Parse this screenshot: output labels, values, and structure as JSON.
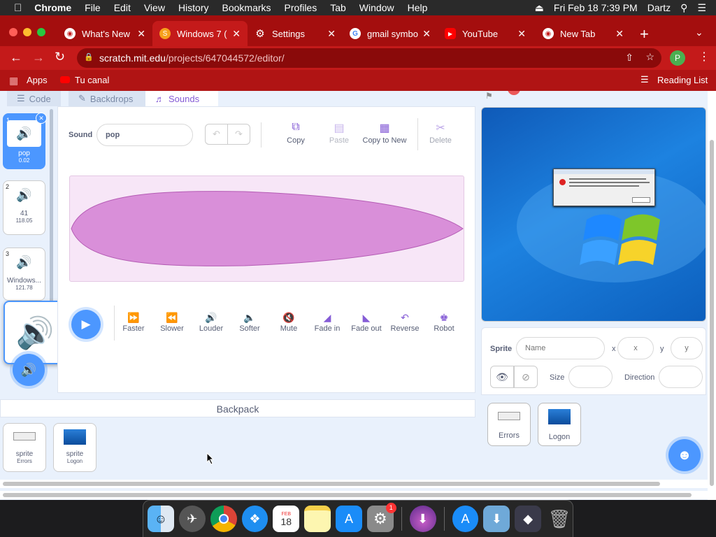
{
  "menubar": {
    "app": "Chrome",
    "items": [
      "File",
      "Edit",
      "View",
      "History",
      "Bookmarks",
      "Profiles",
      "Tab",
      "Window",
      "Help"
    ],
    "clock": "Fri Feb 18  7:39 PM",
    "user": "Dartz"
  },
  "tabs": [
    {
      "title": "What's New",
      "icon": "chrome-icon"
    },
    {
      "title": "Windows 7 (",
      "icon": "scratch-icon"
    },
    {
      "title": "Settings",
      "icon": "gear-icon"
    },
    {
      "title": "gmail symbo",
      "icon": "google-icon"
    },
    {
      "title": "YouTube",
      "icon": "youtube-icon"
    },
    {
      "title": "New Tab",
      "icon": "chrome-icon"
    }
  ],
  "address": {
    "host": "scratch.mit.edu",
    "path": "/projects/647044572/editor/",
    "profile": "P"
  },
  "bookmarks": {
    "apps": "Apps",
    "tu_canal": "Tu canal",
    "reading_list": "Reading List"
  },
  "scratch": {
    "tabs": {
      "code": "Code",
      "backdrops": "Backdrops",
      "sounds": "Sounds"
    },
    "sounds": [
      {
        "num": "1",
        "name": "pop",
        "dur": "0.02"
      },
      {
        "num": "2",
        "name": "41",
        "dur": "118.05"
      },
      {
        "num": "3",
        "name": "Windows...",
        "dur": "121.78"
      }
    ],
    "editor": {
      "sound_label": "Sound",
      "sound_name": "pop",
      "copy": "Copy",
      "paste": "Paste",
      "copy_to_new": "Copy to New",
      "delete": "Delete"
    },
    "effects": [
      "Faster",
      "Slower",
      "Louder",
      "Softer",
      "Mute",
      "Fade in",
      "Fade out",
      "Reverse",
      "Robot"
    ],
    "backpack": {
      "title": "Backpack",
      "items": [
        {
          "type": "sprite",
          "name": "Errors"
        },
        {
          "type": "sprite",
          "name": "Logon"
        }
      ]
    },
    "sprite_info": {
      "sprite_label": "Sprite",
      "name_placeholder": "Name",
      "x_label": "x",
      "x_placeholder": "x",
      "y_label": "y",
      "y_placeholder": "y",
      "size_label": "Size",
      "direction_label": "Direction"
    },
    "sprites": [
      {
        "name": "Errors"
      },
      {
        "name": "Logon"
      }
    ]
  },
  "dock": {
    "calendar_month": "FEB",
    "calendar_day": "18",
    "badge": "1"
  }
}
